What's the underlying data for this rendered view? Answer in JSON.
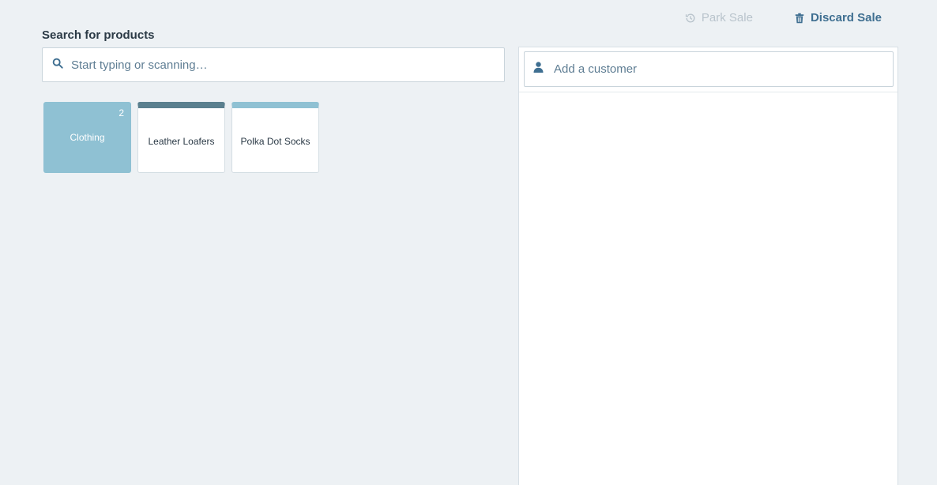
{
  "header": {
    "park_sale_label": "Park Sale",
    "discard_sale_label": "Discard Sale",
    "park_icon": "history-icon",
    "discard_icon": "trash-icon"
  },
  "search": {
    "label": "Search for products",
    "placeholder": "Start typing or scanning…",
    "value": "",
    "icon": "search-icon"
  },
  "tiles": [
    {
      "type": "category",
      "name": "Clothing",
      "count": "2",
      "color": "#8fc1d3"
    },
    {
      "type": "product",
      "name": "Leather Loafers",
      "color": "#5a7f8e"
    },
    {
      "type": "product",
      "name": "Polka Dot Socks",
      "color": "#8fc1d3"
    }
  ],
  "sale": {
    "customer_placeholder": "Add a customer",
    "customer_value": "",
    "customer_icon": "user-icon"
  },
  "colors": {
    "background": "#edf1f4",
    "accent": "#3f6f91",
    "disabled": "#b9c4cc"
  }
}
